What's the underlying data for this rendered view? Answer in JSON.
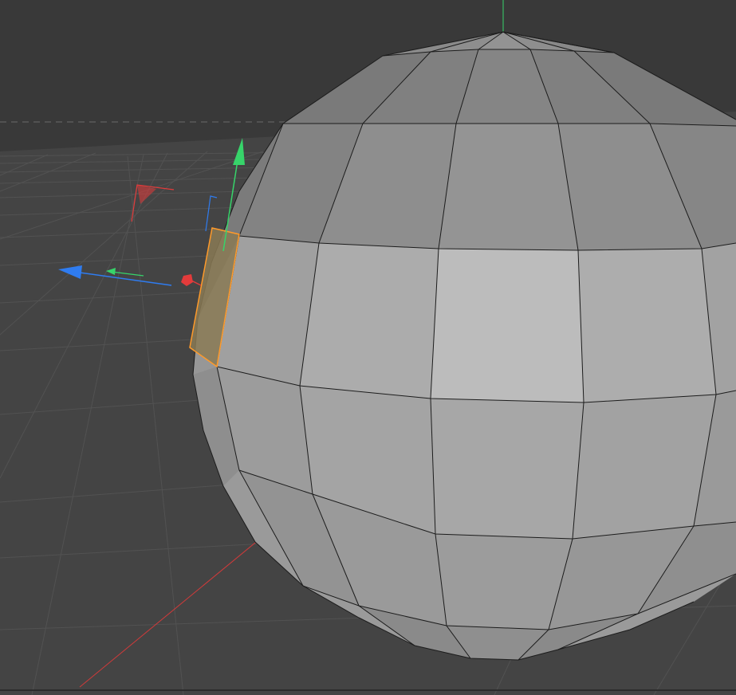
{
  "viewport": {
    "mode": "polygon-selection",
    "colors": {
      "background": "#393939",
      "floor": "#444444",
      "grid_line": "#505050",
      "horizon_line": "#6a6a6a",
      "mesh_face": "#9a9a9a",
      "mesh_face_light": "#bcbcbc",
      "mesh_face_dark": "#6f6f6f",
      "mesh_edge": "#1a1a1a",
      "selection_fill": "#8a7a55",
      "selection_edge": "#ff9a2a",
      "axis_x": "#e33b3b",
      "axis_y": "#37d46a",
      "axis_z": "#2f7cf0"
    },
    "icons": {
      "move_x_handle": "x-axis-arrow-icon",
      "move_y_handle": "y-axis-arrow-icon",
      "move_z_handle": "z-axis-arrow-icon",
      "rotate_handle": "rotate-arc-icon",
      "scale_handle": "scale-cube-icon"
    }
  }
}
